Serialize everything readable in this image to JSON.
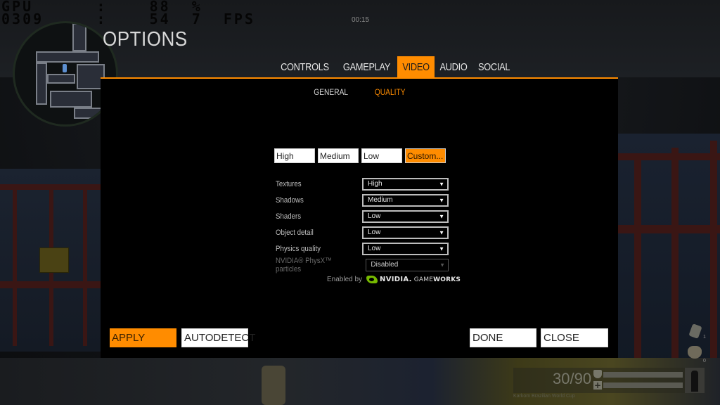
{
  "perf_overlay": {
    "row1": "GPU      :    88  %",
    "row2": "0309     :    54  7  FPS"
  },
  "timer": "00:15",
  "title": "OPTIONS",
  "tabs": [
    {
      "label": "CONTROLS",
      "active": false
    },
    {
      "label": "GAMEPLAY",
      "active": false
    },
    {
      "label": "VIDEO",
      "active": true
    },
    {
      "label": "AUDIO",
      "active": false
    },
    {
      "label": "SOCIAL",
      "active": false
    }
  ],
  "subtabs": [
    {
      "label": "GENERAL",
      "active": false
    },
    {
      "label": "QUALITY",
      "active": true
    }
  ],
  "presets": [
    {
      "label": "High",
      "active": false
    },
    {
      "label": "Medium",
      "active": false
    },
    {
      "label": "Low",
      "active": false
    },
    {
      "label": "Custom...",
      "active": true
    }
  ],
  "settings": [
    {
      "label": "Textures",
      "value": "High",
      "disabled": false
    },
    {
      "label": "Shadows",
      "value": "Medium",
      "disabled": false
    },
    {
      "label": "Shaders",
      "value": "Low",
      "disabled": false
    },
    {
      "label": "Object detail",
      "value": "Low",
      "disabled": false
    },
    {
      "label": "Physics quality",
      "value": "Low",
      "disabled": false
    },
    {
      "label": "NVIDIA® PhysX™ particles",
      "value": "Disabled",
      "disabled": true
    }
  ],
  "enabled_by": {
    "text": "Enabled by",
    "brand": "NVIDIA.",
    "product_light": "GAME",
    "product_bold": "WORKS"
  },
  "buttons": {
    "apply": "APPLY",
    "autodetect": "AUTODETECT",
    "done": "DONE",
    "close": "CLOSE"
  },
  "hud": {
    "ammo": "30/90",
    "map_name": "Karkom Brazilian World Cup",
    "item1_count": "1",
    "item2_count": "0"
  },
  "colors": {
    "accent": "#ff8c00",
    "panel_bg": "#000000",
    "nvidia_green": "#76b900"
  }
}
